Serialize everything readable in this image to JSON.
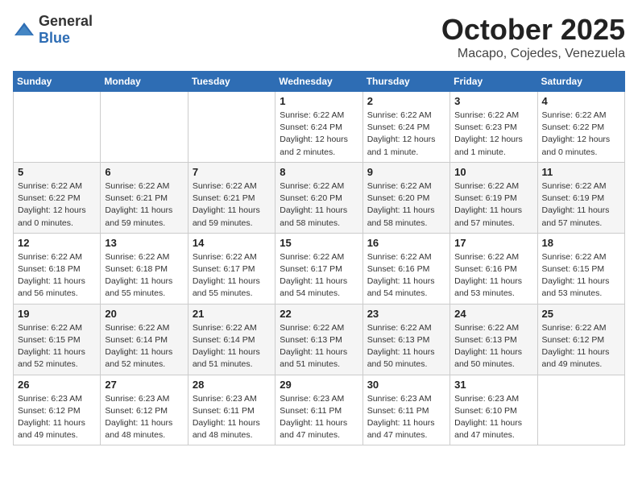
{
  "logo": {
    "general": "General",
    "blue": "Blue"
  },
  "header": {
    "month": "October 2025",
    "location": "Macapo, Cojedes, Venezuela"
  },
  "weekdays": [
    "Sunday",
    "Monday",
    "Tuesday",
    "Wednesday",
    "Thursday",
    "Friday",
    "Saturday"
  ],
  "weeks": [
    [
      {
        "day": "",
        "info": ""
      },
      {
        "day": "",
        "info": ""
      },
      {
        "day": "",
        "info": ""
      },
      {
        "day": "1",
        "info": "Sunrise: 6:22 AM\nSunset: 6:24 PM\nDaylight: 12 hours\nand 2 minutes."
      },
      {
        "day": "2",
        "info": "Sunrise: 6:22 AM\nSunset: 6:24 PM\nDaylight: 12 hours\nand 1 minute."
      },
      {
        "day": "3",
        "info": "Sunrise: 6:22 AM\nSunset: 6:23 PM\nDaylight: 12 hours\nand 1 minute."
      },
      {
        "day": "4",
        "info": "Sunrise: 6:22 AM\nSunset: 6:22 PM\nDaylight: 12 hours\nand 0 minutes."
      }
    ],
    [
      {
        "day": "5",
        "info": "Sunrise: 6:22 AM\nSunset: 6:22 PM\nDaylight: 12 hours\nand 0 minutes."
      },
      {
        "day": "6",
        "info": "Sunrise: 6:22 AM\nSunset: 6:21 PM\nDaylight: 11 hours\nand 59 minutes."
      },
      {
        "day": "7",
        "info": "Sunrise: 6:22 AM\nSunset: 6:21 PM\nDaylight: 11 hours\nand 59 minutes."
      },
      {
        "day": "8",
        "info": "Sunrise: 6:22 AM\nSunset: 6:20 PM\nDaylight: 11 hours\nand 58 minutes."
      },
      {
        "day": "9",
        "info": "Sunrise: 6:22 AM\nSunset: 6:20 PM\nDaylight: 11 hours\nand 58 minutes."
      },
      {
        "day": "10",
        "info": "Sunrise: 6:22 AM\nSunset: 6:19 PM\nDaylight: 11 hours\nand 57 minutes."
      },
      {
        "day": "11",
        "info": "Sunrise: 6:22 AM\nSunset: 6:19 PM\nDaylight: 11 hours\nand 57 minutes."
      }
    ],
    [
      {
        "day": "12",
        "info": "Sunrise: 6:22 AM\nSunset: 6:18 PM\nDaylight: 11 hours\nand 56 minutes."
      },
      {
        "day": "13",
        "info": "Sunrise: 6:22 AM\nSunset: 6:18 PM\nDaylight: 11 hours\nand 55 minutes."
      },
      {
        "day": "14",
        "info": "Sunrise: 6:22 AM\nSunset: 6:17 PM\nDaylight: 11 hours\nand 55 minutes."
      },
      {
        "day": "15",
        "info": "Sunrise: 6:22 AM\nSunset: 6:17 PM\nDaylight: 11 hours\nand 54 minutes."
      },
      {
        "day": "16",
        "info": "Sunrise: 6:22 AM\nSunset: 6:16 PM\nDaylight: 11 hours\nand 54 minutes."
      },
      {
        "day": "17",
        "info": "Sunrise: 6:22 AM\nSunset: 6:16 PM\nDaylight: 11 hours\nand 53 minutes."
      },
      {
        "day": "18",
        "info": "Sunrise: 6:22 AM\nSunset: 6:15 PM\nDaylight: 11 hours\nand 53 minutes."
      }
    ],
    [
      {
        "day": "19",
        "info": "Sunrise: 6:22 AM\nSunset: 6:15 PM\nDaylight: 11 hours\nand 52 minutes."
      },
      {
        "day": "20",
        "info": "Sunrise: 6:22 AM\nSunset: 6:14 PM\nDaylight: 11 hours\nand 52 minutes."
      },
      {
        "day": "21",
        "info": "Sunrise: 6:22 AM\nSunset: 6:14 PM\nDaylight: 11 hours\nand 51 minutes."
      },
      {
        "day": "22",
        "info": "Sunrise: 6:22 AM\nSunset: 6:13 PM\nDaylight: 11 hours\nand 51 minutes."
      },
      {
        "day": "23",
        "info": "Sunrise: 6:22 AM\nSunset: 6:13 PM\nDaylight: 11 hours\nand 50 minutes."
      },
      {
        "day": "24",
        "info": "Sunrise: 6:22 AM\nSunset: 6:13 PM\nDaylight: 11 hours\nand 50 minutes."
      },
      {
        "day": "25",
        "info": "Sunrise: 6:22 AM\nSunset: 6:12 PM\nDaylight: 11 hours\nand 49 minutes."
      }
    ],
    [
      {
        "day": "26",
        "info": "Sunrise: 6:23 AM\nSunset: 6:12 PM\nDaylight: 11 hours\nand 49 minutes."
      },
      {
        "day": "27",
        "info": "Sunrise: 6:23 AM\nSunset: 6:12 PM\nDaylight: 11 hours\nand 48 minutes."
      },
      {
        "day": "28",
        "info": "Sunrise: 6:23 AM\nSunset: 6:11 PM\nDaylight: 11 hours\nand 48 minutes."
      },
      {
        "day": "29",
        "info": "Sunrise: 6:23 AM\nSunset: 6:11 PM\nDaylight: 11 hours\nand 47 minutes."
      },
      {
        "day": "30",
        "info": "Sunrise: 6:23 AM\nSunset: 6:11 PM\nDaylight: 11 hours\nand 47 minutes."
      },
      {
        "day": "31",
        "info": "Sunrise: 6:23 AM\nSunset: 6:10 PM\nDaylight: 11 hours\nand 47 minutes."
      },
      {
        "day": "",
        "info": ""
      }
    ]
  ]
}
